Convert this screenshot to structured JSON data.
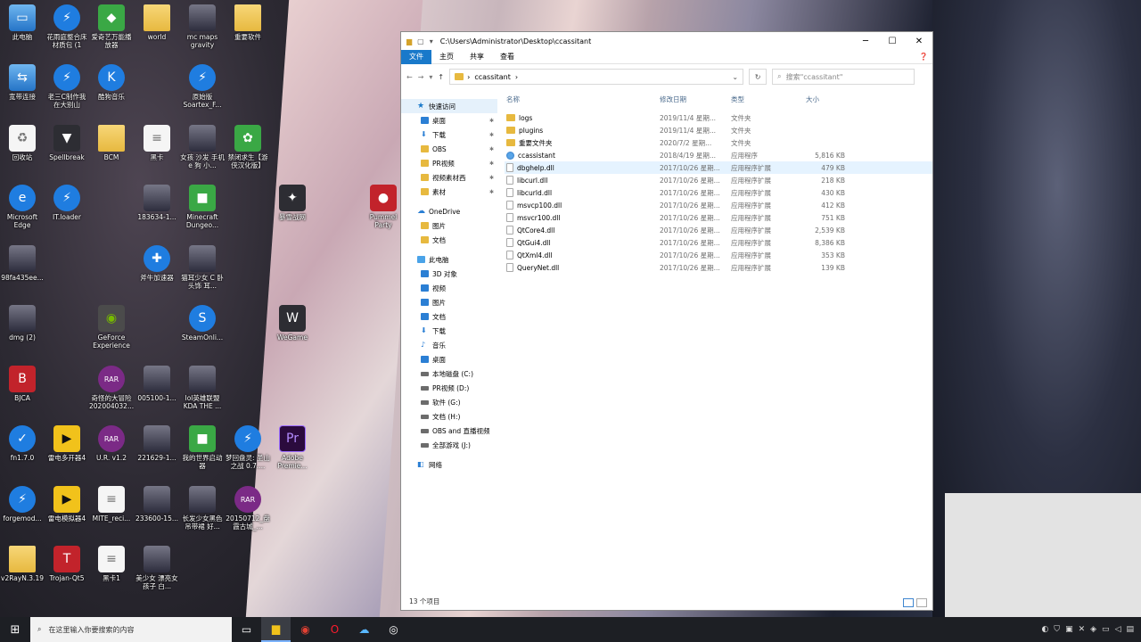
{
  "desktop": {
    "icons": [
      {
        "label": "此电脑",
        "icon": "computer-icon"
      },
      {
        "label": "花雨庭整合床材质包 (1",
        "icon": "blue-app-icon"
      },
      {
        "label": "爱奇艺万能播放器",
        "icon": "iqiyi-icon"
      },
      {
        "label": "world",
        "icon": "folder-icon"
      },
      {
        "label": "mc maps gravity",
        "icon": "image-icon"
      },
      {
        "label": "重要软件",
        "icon": "folder-icon"
      },
      {
        "label": "宽带连接",
        "icon": "network-icon"
      },
      {
        "label": "老三C制作我在大别山",
        "icon": "blue-app-icon"
      },
      {
        "label": "酷狗音乐",
        "icon": "kugou-icon"
      },
      {
        "label": "原始版 Soartex_F...",
        "icon": "blue-app-icon"
      },
      {
        "label": "回收站",
        "icon": "recycle-bin-icon"
      },
      {
        "label": "Spellbreak",
        "icon": "spellbreak-icon"
      },
      {
        "label": "BCM",
        "icon": "folder-icon"
      },
      {
        "label": "黑卡",
        "icon": "document-icon"
      },
      {
        "label": "女孩 沙发 手机 e 狗 小...",
        "icon": "image-icon"
      },
      {
        "label": "禁闭求生【游侠汉化版】",
        "icon": "grounded-icon"
      },
      {
        "label": "Microsoft Edge",
        "icon": "edge-icon"
      },
      {
        "label": "IT.loader",
        "icon": "blue-app-icon"
      },
      {
        "label": "183634-1...",
        "icon": "image-icon"
      },
      {
        "label": "Minecraft Dungeo...",
        "icon": "minecraft-icon"
      },
      {
        "label": "暴雪战网",
        "icon": "battlenet-icon"
      },
      {
        "label": "Pummel Party",
        "icon": "pummel-party-icon"
      },
      {
        "label": "98fa435ee...",
        "icon": "image-icon"
      },
      {
        "label": "斧牛加速器",
        "icon": "accelerator-icon"
      },
      {
        "label": "猫耳少女 C 卧 头饰 耳...",
        "icon": "image-icon"
      },
      {
        "label": "dmg (2)",
        "icon": "image-icon"
      },
      {
        "label": "GeForce Experience",
        "icon": "nvidia-icon"
      },
      {
        "label": "SteamOnli...",
        "icon": "steam-icon"
      },
      {
        "label": "WeGame",
        "icon": "wegame-icon"
      },
      {
        "label": "BJCA",
        "icon": "bjca-icon"
      },
      {
        "label": "奇怪的大冒险 202004032...",
        "icon": "rar-icon"
      },
      {
        "label": "005100-1...",
        "icon": "image-icon"
      },
      {
        "label": "lol英雄联盟 KDA THE ...",
        "icon": "image-icon"
      },
      {
        "label": "fn1.7.0",
        "icon": "shield-icon"
      },
      {
        "label": "雷电多开器4",
        "icon": "ldplayer-icon"
      },
      {
        "label": "U.R. v1.2",
        "icon": "rar-icon"
      },
      {
        "label": "221629-1...",
        "icon": "image-icon"
      },
      {
        "label": "我的世界启动器",
        "icon": "minecraft-icon"
      },
      {
        "label": "梦回盘灵: 圣山之战 0.7....",
        "icon": "blue-app-icon"
      },
      {
        "label": "Adobe Premie...",
        "icon": "premiere-icon"
      },
      {
        "label": "forgemod...",
        "icon": "blue-app-icon"
      },
      {
        "label": "雷电模拟器4",
        "icon": "ldplayer-icon"
      },
      {
        "label": "MITE_reci...",
        "icon": "document-icon"
      },
      {
        "label": "233600-15...",
        "icon": "image-icon"
      },
      {
        "label": "长发少女黑色吊带裙 好...",
        "icon": "image-icon"
      },
      {
        "label": "20150712_盘霞古城_...",
        "icon": "rar-icon"
      },
      {
        "label": "v2RayN.3.19",
        "icon": "folder-icon"
      },
      {
        "label": "Trojan-Qt5",
        "icon": "trojan-icon"
      },
      {
        "label": "黑卡1",
        "icon": "document-icon"
      },
      {
        "label": "美少女 漂亮女孩子 白...",
        "icon": "image-icon"
      }
    ]
  },
  "explorer": {
    "title_path": "C:\\Users\\Administrator\\Desktop\\ccassitant",
    "window_buttons": {
      "minimize": "─",
      "maximize": "☐",
      "close": "✕"
    },
    "ribbon_tabs": [
      "文件",
      "主页",
      "共享",
      "查看"
    ],
    "address": {
      "crumb_root": "›",
      "crumb": "ccassitant",
      "crumb_sep": "›"
    },
    "search_placeholder": "搜索\"ccassitant\"",
    "nav": {
      "quick_access": "快速访问",
      "quick_items": [
        "桌面",
        "下载",
        "OBS",
        "PR视频",
        "视频素材西",
        "素材"
      ],
      "onedrive": "OneDrive",
      "onedrive_items": [
        "图片",
        "文档"
      ],
      "this_pc": "此电脑",
      "pc_items": [
        "3D 对象",
        "视频",
        "图片",
        "文档",
        "下载",
        "音乐",
        "桌面"
      ],
      "drives": [
        "本地磁盘 (C:)",
        "PR视频 (D:)",
        "软件 (G:)",
        "文档 (H:)",
        "OBS and 直播视频",
        "全部游戏 (J:)"
      ],
      "network": "网络"
    },
    "columns": {
      "name": "名称",
      "date": "修改日期",
      "type": "类型",
      "size": "大小"
    },
    "files": [
      {
        "name": "logs",
        "date": "2019/11/4 星期...",
        "type": "文件夹",
        "size": "",
        "kind": "folder"
      },
      {
        "name": "plugins",
        "date": "2019/11/4 星期...",
        "type": "文件夹",
        "size": "",
        "kind": "folder"
      },
      {
        "name": "重要文件夹",
        "date": "2020/7/2 星期...",
        "type": "文件夹",
        "size": "",
        "kind": "folder"
      },
      {
        "name": "ccassistant",
        "date": "2018/4/19 星期...",
        "type": "应用程序",
        "size": "5,816 KB",
        "kind": "app"
      },
      {
        "name": "dbghelp.dll",
        "date": "2017/10/26 星期...",
        "type": "应用程序扩展",
        "size": "479 KB",
        "kind": "file"
      },
      {
        "name": "libcurl.dll",
        "date": "2017/10/26 星期...",
        "type": "应用程序扩展",
        "size": "218 KB",
        "kind": "file"
      },
      {
        "name": "libcurld.dll",
        "date": "2017/10/26 星期...",
        "type": "应用程序扩展",
        "size": "430 KB",
        "kind": "file"
      },
      {
        "name": "msvcp100.dll",
        "date": "2017/10/26 星期...",
        "type": "应用程序扩展",
        "size": "412 KB",
        "kind": "file"
      },
      {
        "name": "msvcr100.dll",
        "date": "2017/10/26 星期...",
        "type": "应用程序扩展",
        "size": "751 KB",
        "kind": "file"
      },
      {
        "name": "QtCore4.dll",
        "date": "2017/10/26 星期...",
        "type": "应用程序扩展",
        "size": "2,539 KB",
        "kind": "file"
      },
      {
        "name": "QtGui4.dll",
        "date": "2017/10/26 星期...",
        "type": "应用程序扩展",
        "size": "8,386 KB",
        "kind": "file"
      },
      {
        "name": "QtXml4.dll",
        "date": "2017/10/26 星期...",
        "type": "应用程序扩展",
        "size": "353 KB",
        "kind": "file"
      },
      {
        "name": "QueryNet.dll",
        "date": "2017/10/26 星期...",
        "type": "应用程序扩展",
        "size": "139 KB",
        "kind": "file"
      }
    ],
    "status": "13 个项目"
  },
  "taskbar": {
    "search_placeholder": "在这里输入你要搜索的内容",
    "apps": [
      "task-view-icon",
      "file-explorer-icon",
      "chrome-icon",
      "opera-icon",
      "game-app-icon",
      "obs-icon"
    ]
  }
}
